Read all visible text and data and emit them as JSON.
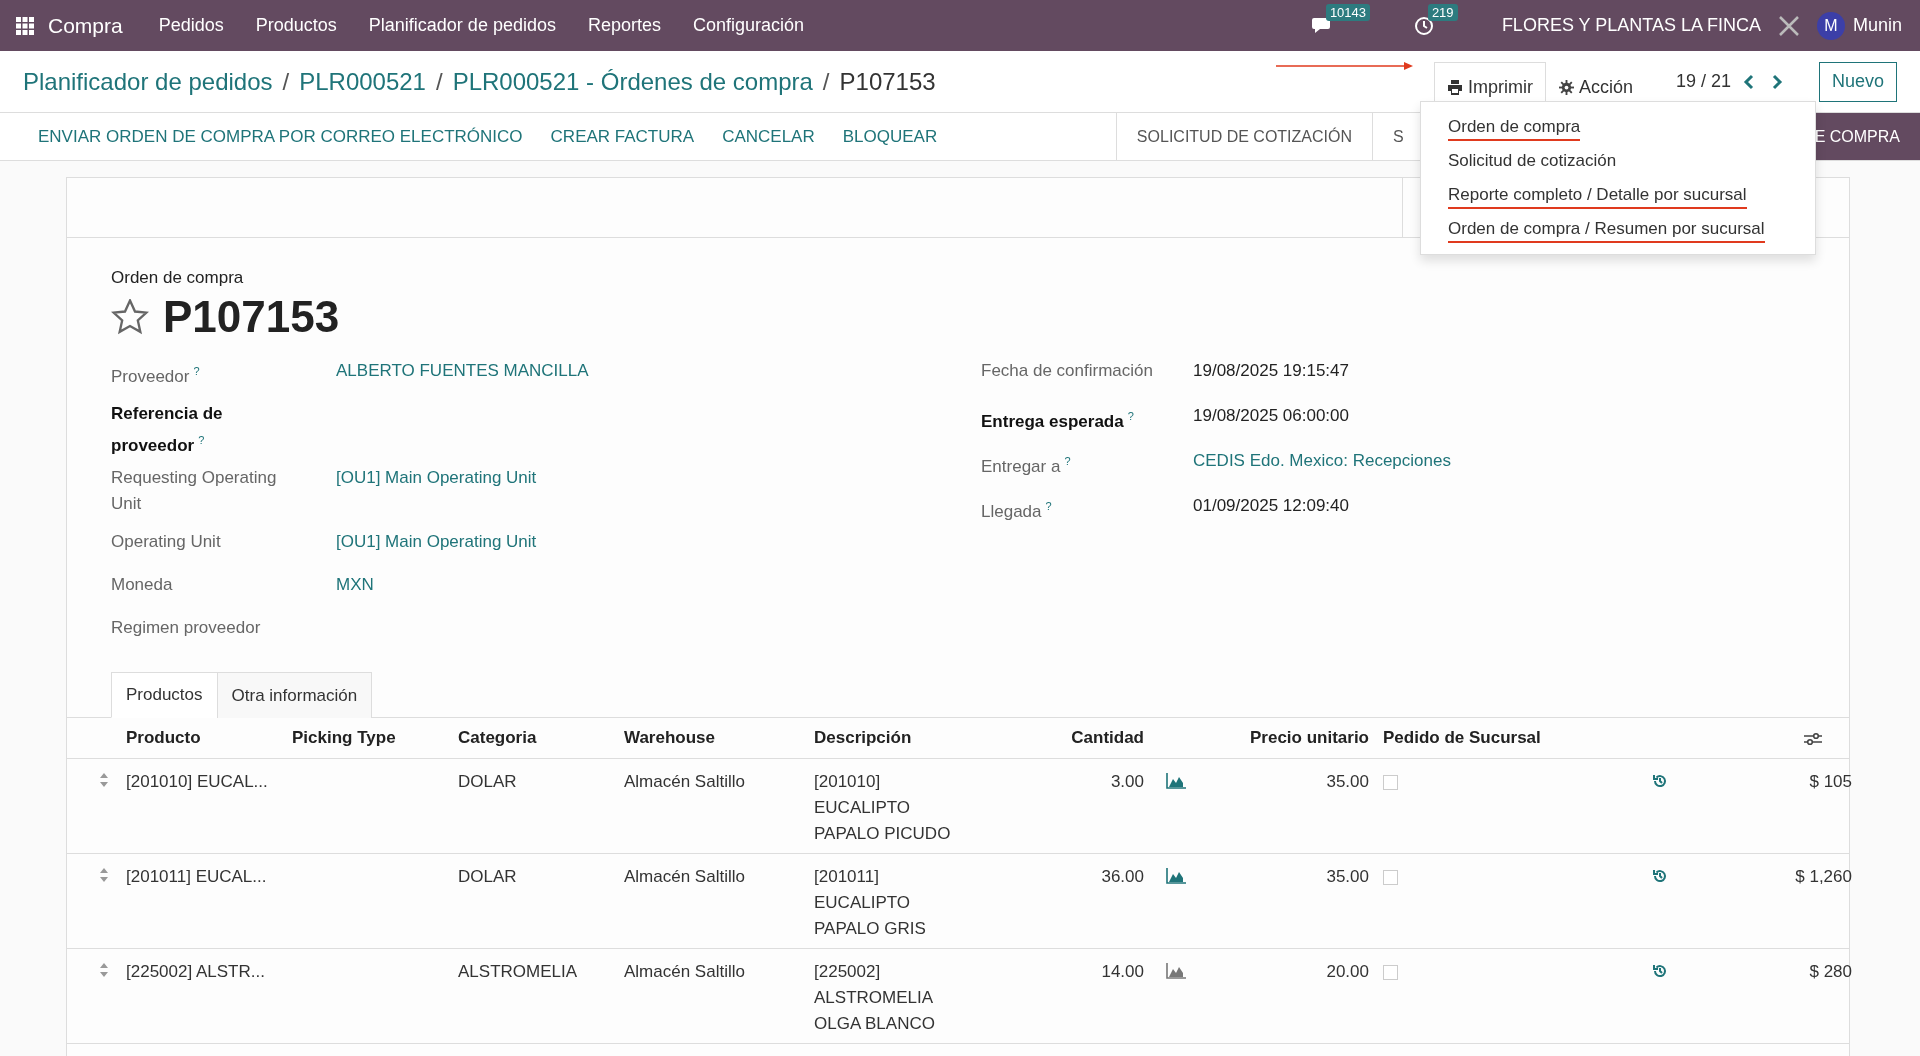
{
  "navbar": {
    "app": "Compra",
    "menu": [
      "Pedidos",
      "Productos",
      "Planificador de pedidos",
      "Reportes",
      "Configuración"
    ],
    "messages_badge": "10143",
    "activities_badge": "219",
    "company": "FLORES Y PLANTAS LA FINCA",
    "avatar_letter": "M",
    "user": "Munin"
  },
  "breadcrumbs": [
    "Planificador de pedidos",
    "PLR000521",
    "PLR000521 - Órdenes de compra"
  ],
  "breadcrumb_separator": "/",
  "current": "P107153",
  "print_menu": {
    "label": "Imprimir",
    "expanded": true,
    "items": [
      {
        "label": "Orden de compra",
        "underlined": true
      },
      {
        "label": "Solicitud de cotización",
        "underlined": false
      },
      {
        "label": "Reporte completo / Detalle por sucursal",
        "underlined": true
      },
      {
        "label": "Orden de compra / Resumen por sucursal",
        "underlined": true
      }
    ]
  },
  "action_label": "Acción",
  "pager": "19 / 21",
  "new_button": "Nuevo",
  "actions": [
    "ENVIAR ORDEN DE COMPRA POR CORREO ELECTRÓNICO",
    "CREAR FACTURA",
    "CANCELAR",
    "BLOQUEAR"
  ],
  "stages": [
    {
      "label": "SOLICITUD DE COTIZACIÓN",
      "selected": false
    },
    {
      "label": "S",
      "selected": false
    },
    {
      "label": "E COMPRA",
      "selected": true
    }
  ],
  "form": {
    "subtitle": "Orden de compra",
    "name": "P107153",
    "starred": false,
    "left_fields": [
      {
        "label": "Proveedor",
        "help": "?",
        "value": "ALBERTO FUENTES MANCILLA",
        "bold": false,
        "link": true
      },
      {
        "label": "Referencia de proveedor",
        "help": "?",
        "bold": true
      },
      {
        "label": "Requesting Operating Unit",
        "value": "[OU1] Main Operating Unit",
        "bold": false,
        "link": true
      },
      {
        "label": "Operating Unit",
        "value": "[OU1] Main Operating Unit",
        "bold": false,
        "link": true
      },
      {
        "label": "Moneda",
        "value": "MXN",
        "bold": false,
        "link": true
      },
      {
        "label": "Regimen proveedor",
        "bold": false
      }
    ],
    "right_fields": [
      {
        "label": "Fecha de confirmación",
        "value": "19/08/2025 19:15:47",
        "bold": false,
        "link": false
      },
      {
        "label": "Entrega esperada",
        "help": "?",
        "value": "19/08/2025 06:00:00",
        "bold": true,
        "link": false
      },
      {
        "label": "Entregar a",
        "help": "?",
        "value": "CEDIS Edo. Mexico: Recepciones",
        "bold": false,
        "link": true
      },
      {
        "label": "Llegada",
        "help": "?",
        "value": "01/09/2025 12:09:40",
        "bold": false,
        "link": false
      }
    ]
  },
  "tabs": [
    {
      "label": "Productos",
      "selected": true
    },
    {
      "label": "Otra información",
      "selected": false
    }
  ],
  "table": {
    "columns": [
      "Producto",
      "Picking Type",
      "Categoria",
      "Warehouse",
      "Descripción",
      "Cantidad",
      "Precio unitario",
      "Pedido de Sucursal"
    ],
    "rows": [
      {
        "product": "[201010] EUCAL...",
        "category": "DOLAR",
        "warehouse": "Almacén Saltillo",
        "description": [
          "[201010]",
          "EUCALIPTO",
          "PAPALO PICUDO"
        ],
        "quantity": "3.00",
        "forecast_highlighted": true,
        "price": "35.00",
        "branch_order": false,
        "subtotal": "$ 105"
      },
      {
        "product": "[201011] EUCAL...",
        "category": "DOLAR",
        "warehouse": "Almacén Saltillo",
        "description": [
          "[201011]",
          "EUCALIPTO",
          "PAPALO GRIS"
        ],
        "quantity": "36.00",
        "forecast_highlighted": true,
        "price": "35.00",
        "branch_order": false,
        "subtotal": "$ 1,260"
      },
      {
        "product": "[225002] ALSTR...",
        "category": "ALSTROMELIA",
        "warehouse": "Almacén Saltillo",
        "description": [
          "[225002]",
          "ALSTROMELIA",
          "OLGA BLANCO"
        ],
        "quantity": "14.00",
        "forecast_highlighted": false,
        "price": "20.00",
        "branch_order": false,
        "subtotal": "$ 280"
      }
    ]
  }
}
